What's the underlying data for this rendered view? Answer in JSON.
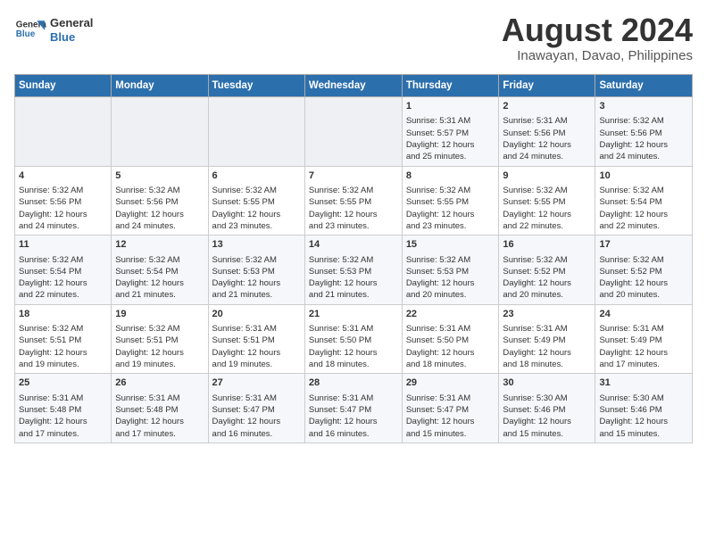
{
  "header": {
    "logo_line1": "General",
    "logo_line2": "Blue",
    "month_title": "August 2024",
    "location": "Inawayan, Davao, Philippines"
  },
  "days_of_week": [
    "Sunday",
    "Monday",
    "Tuesday",
    "Wednesday",
    "Thursday",
    "Friday",
    "Saturday"
  ],
  "weeks": [
    [
      {
        "day": "",
        "info": ""
      },
      {
        "day": "",
        "info": ""
      },
      {
        "day": "",
        "info": ""
      },
      {
        "day": "",
        "info": ""
      },
      {
        "day": "1",
        "info": "Sunrise: 5:31 AM\nSunset: 5:57 PM\nDaylight: 12 hours\nand 25 minutes."
      },
      {
        "day": "2",
        "info": "Sunrise: 5:31 AM\nSunset: 5:56 PM\nDaylight: 12 hours\nand 24 minutes."
      },
      {
        "day": "3",
        "info": "Sunrise: 5:32 AM\nSunset: 5:56 PM\nDaylight: 12 hours\nand 24 minutes."
      }
    ],
    [
      {
        "day": "4",
        "info": "Sunrise: 5:32 AM\nSunset: 5:56 PM\nDaylight: 12 hours\nand 24 minutes."
      },
      {
        "day": "5",
        "info": "Sunrise: 5:32 AM\nSunset: 5:56 PM\nDaylight: 12 hours\nand 24 minutes."
      },
      {
        "day": "6",
        "info": "Sunrise: 5:32 AM\nSunset: 5:55 PM\nDaylight: 12 hours\nand 23 minutes."
      },
      {
        "day": "7",
        "info": "Sunrise: 5:32 AM\nSunset: 5:55 PM\nDaylight: 12 hours\nand 23 minutes."
      },
      {
        "day": "8",
        "info": "Sunrise: 5:32 AM\nSunset: 5:55 PM\nDaylight: 12 hours\nand 23 minutes."
      },
      {
        "day": "9",
        "info": "Sunrise: 5:32 AM\nSunset: 5:55 PM\nDaylight: 12 hours\nand 22 minutes."
      },
      {
        "day": "10",
        "info": "Sunrise: 5:32 AM\nSunset: 5:54 PM\nDaylight: 12 hours\nand 22 minutes."
      }
    ],
    [
      {
        "day": "11",
        "info": "Sunrise: 5:32 AM\nSunset: 5:54 PM\nDaylight: 12 hours\nand 22 minutes."
      },
      {
        "day": "12",
        "info": "Sunrise: 5:32 AM\nSunset: 5:54 PM\nDaylight: 12 hours\nand 21 minutes."
      },
      {
        "day": "13",
        "info": "Sunrise: 5:32 AM\nSunset: 5:53 PM\nDaylight: 12 hours\nand 21 minutes."
      },
      {
        "day": "14",
        "info": "Sunrise: 5:32 AM\nSunset: 5:53 PM\nDaylight: 12 hours\nand 21 minutes."
      },
      {
        "day": "15",
        "info": "Sunrise: 5:32 AM\nSunset: 5:53 PM\nDaylight: 12 hours\nand 20 minutes."
      },
      {
        "day": "16",
        "info": "Sunrise: 5:32 AM\nSunset: 5:52 PM\nDaylight: 12 hours\nand 20 minutes."
      },
      {
        "day": "17",
        "info": "Sunrise: 5:32 AM\nSunset: 5:52 PM\nDaylight: 12 hours\nand 20 minutes."
      }
    ],
    [
      {
        "day": "18",
        "info": "Sunrise: 5:32 AM\nSunset: 5:51 PM\nDaylight: 12 hours\nand 19 minutes."
      },
      {
        "day": "19",
        "info": "Sunrise: 5:32 AM\nSunset: 5:51 PM\nDaylight: 12 hours\nand 19 minutes."
      },
      {
        "day": "20",
        "info": "Sunrise: 5:31 AM\nSunset: 5:51 PM\nDaylight: 12 hours\nand 19 minutes."
      },
      {
        "day": "21",
        "info": "Sunrise: 5:31 AM\nSunset: 5:50 PM\nDaylight: 12 hours\nand 18 minutes."
      },
      {
        "day": "22",
        "info": "Sunrise: 5:31 AM\nSunset: 5:50 PM\nDaylight: 12 hours\nand 18 minutes."
      },
      {
        "day": "23",
        "info": "Sunrise: 5:31 AM\nSunset: 5:49 PM\nDaylight: 12 hours\nand 18 minutes."
      },
      {
        "day": "24",
        "info": "Sunrise: 5:31 AM\nSunset: 5:49 PM\nDaylight: 12 hours\nand 17 minutes."
      }
    ],
    [
      {
        "day": "25",
        "info": "Sunrise: 5:31 AM\nSunset: 5:48 PM\nDaylight: 12 hours\nand 17 minutes."
      },
      {
        "day": "26",
        "info": "Sunrise: 5:31 AM\nSunset: 5:48 PM\nDaylight: 12 hours\nand 17 minutes."
      },
      {
        "day": "27",
        "info": "Sunrise: 5:31 AM\nSunset: 5:47 PM\nDaylight: 12 hours\nand 16 minutes."
      },
      {
        "day": "28",
        "info": "Sunrise: 5:31 AM\nSunset: 5:47 PM\nDaylight: 12 hours\nand 16 minutes."
      },
      {
        "day": "29",
        "info": "Sunrise: 5:31 AM\nSunset: 5:47 PM\nDaylight: 12 hours\nand 15 minutes."
      },
      {
        "day": "30",
        "info": "Sunrise: 5:30 AM\nSunset: 5:46 PM\nDaylight: 12 hours\nand 15 minutes."
      },
      {
        "day": "31",
        "info": "Sunrise: 5:30 AM\nSunset: 5:46 PM\nDaylight: 12 hours\nand 15 minutes."
      }
    ]
  ]
}
